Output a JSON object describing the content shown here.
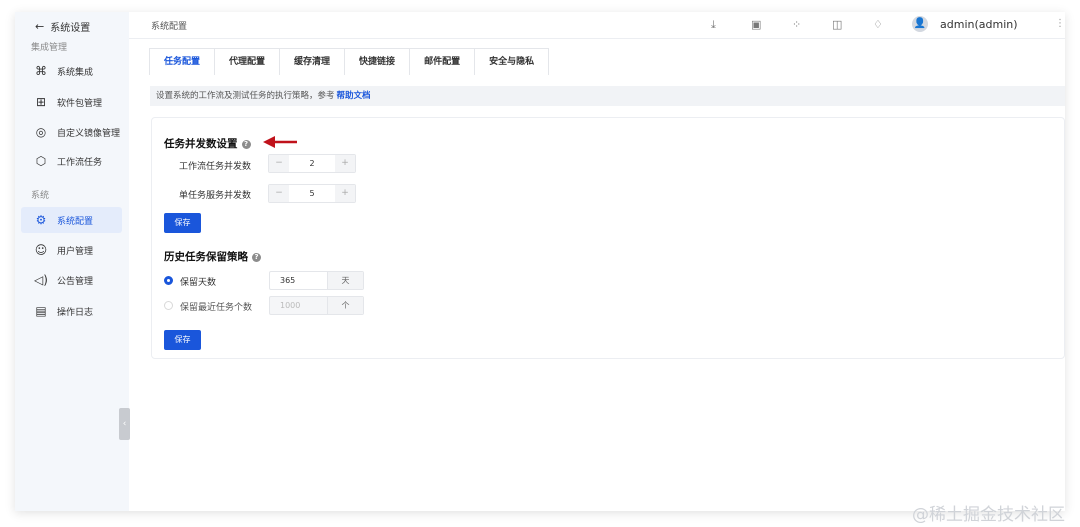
{
  "sidebar": {
    "back_label": "系统设置",
    "group1_title": "集成管理",
    "group2_title": "系统",
    "items": [
      {
        "label": "系统集成",
        "icon": "command-icon"
      },
      {
        "label": "软件包管理",
        "icon": "grid-icon"
      },
      {
        "label": "自定义镜像管理",
        "icon": "target-icon"
      },
      {
        "label": "工作流任务",
        "icon": "cube-icon"
      },
      {
        "label": "系统配置",
        "icon": "gear-icon",
        "active": true
      },
      {
        "label": "用户管理",
        "icon": "user-icon"
      },
      {
        "label": "公告管理",
        "icon": "speaker-icon"
      },
      {
        "label": "操作日志",
        "icon": "clipboard-icon"
      }
    ]
  },
  "header": {
    "page_title": "系统配置",
    "username": "admin(admin)"
  },
  "tabs": [
    {
      "label": "任务配置",
      "active": true
    },
    {
      "label": "代理配置"
    },
    {
      "label": "缓存清理"
    },
    {
      "label": "快捷链接"
    },
    {
      "label": "邮件配置"
    },
    {
      "label": "安全与隐私"
    }
  ],
  "info": {
    "text": "设置系统的工作流及测试任务的执行策略，参考",
    "link": "帮助文档"
  },
  "concurrency": {
    "title": "任务并发数设置",
    "workflow_label": "工作流任务并发数",
    "workflow_value": "2",
    "service_label": "单任务服务并发数",
    "service_value": "5",
    "save_label": "保存"
  },
  "retention": {
    "title": "历史任务保留策略",
    "days_label": "保留天数",
    "days_value": "365",
    "days_unit": "天",
    "count_label": "保留最近任务个数",
    "count_value": "1000",
    "count_unit": "个",
    "save_label": "保存"
  },
  "common": {
    "minus": "−",
    "plus": "+",
    "help": "?"
  },
  "watermark": "@稀土掘金技术社区",
  "colors": {
    "accent": "#1a56db",
    "arrow": "#c0121b"
  }
}
